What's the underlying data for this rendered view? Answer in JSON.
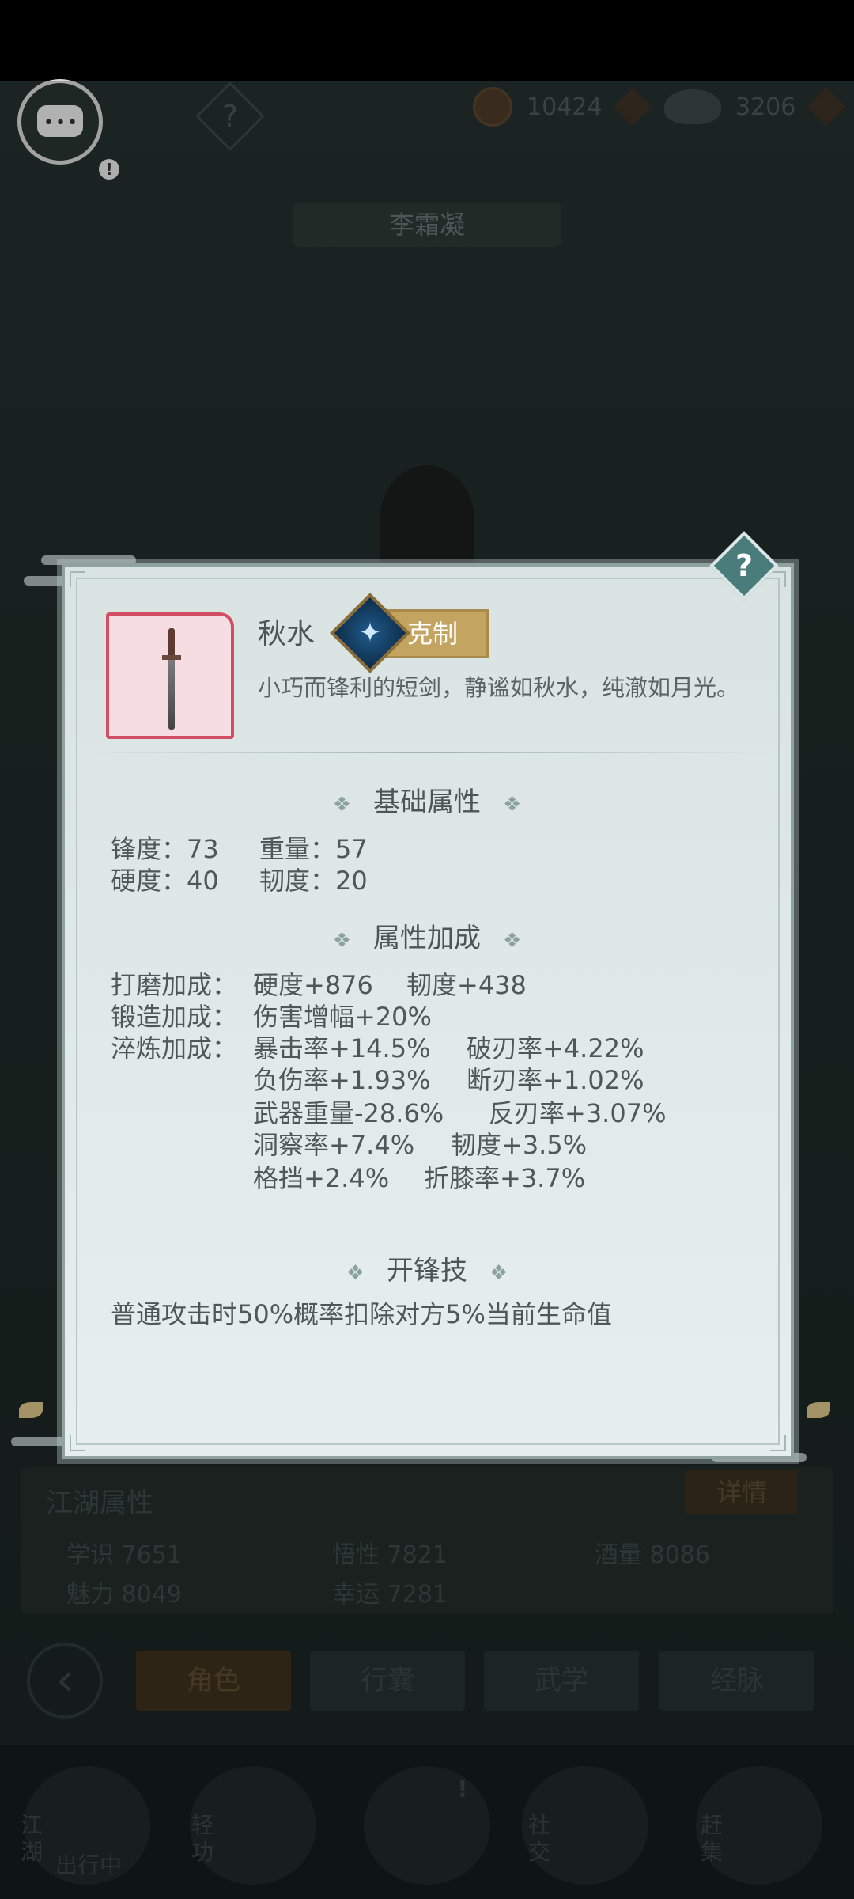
{
  "top_bar": {
    "currency1_value": "10424",
    "currency2_value": "3206",
    "help_glyph": "?",
    "chat_badge": "!"
  },
  "character": {
    "name": "李霜凝"
  },
  "item": {
    "name": "秋水",
    "counter_label": "克制",
    "description": "小巧而锋利的短剑，静谧如秋水，纯澈如月光。"
  },
  "sections": {
    "basic_title": "基础属性",
    "bonus_title": "属性加成",
    "skill_title": "开锋技",
    "ornament": "❖"
  },
  "basic_attrs": {
    "sharpness": "锋度：73",
    "weight": "重量：57",
    "hardness": "硬度：40",
    "toughness": "韧度：20"
  },
  "bonus": {
    "grind_label": "打磨加成：",
    "grind_1": "硬度+876",
    "grind_2": "韧度+438",
    "forge_label": "锻造加成：",
    "forge_1": "伤害增幅+20%",
    "temper_label": "淬炼加成：",
    "temper": [
      "暴击率+14.5%",
      "破刃率+4.22%",
      "负伤率+1.93%",
      "断刃率+1.02%",
      "武器重量-28.6%",
      "反刃率+3.07%",
      "洞察率+7.4%",
      "韧度+3.5%",
      "格挡+2.4%",
      "折膝率+3.7%"
    ]
  },
  "skill": {
    "text": "普通攻击时50%概率扣除对方5%当前生命值"
  },
  "lower_panel": {
    "title": "江湖属性",
    "detail_button": "详情",
    "stats": [
      "学识 7651",
      "悟性 7821",
      "酒量 8086",
      "魅力 8049",
      "幸运 7281"
    ]
  },
  "tabs": [
    "角色",
    "行囊",
    "武学",
    "经脉"
  ],
  "bottom_nav": {
    "item1_label": "江湖",
    "item1_sub": "出行中",
    "item2_label": "轻功",
    "item4_label": "社交",
    "item5_label": "赶集"
  }
}
